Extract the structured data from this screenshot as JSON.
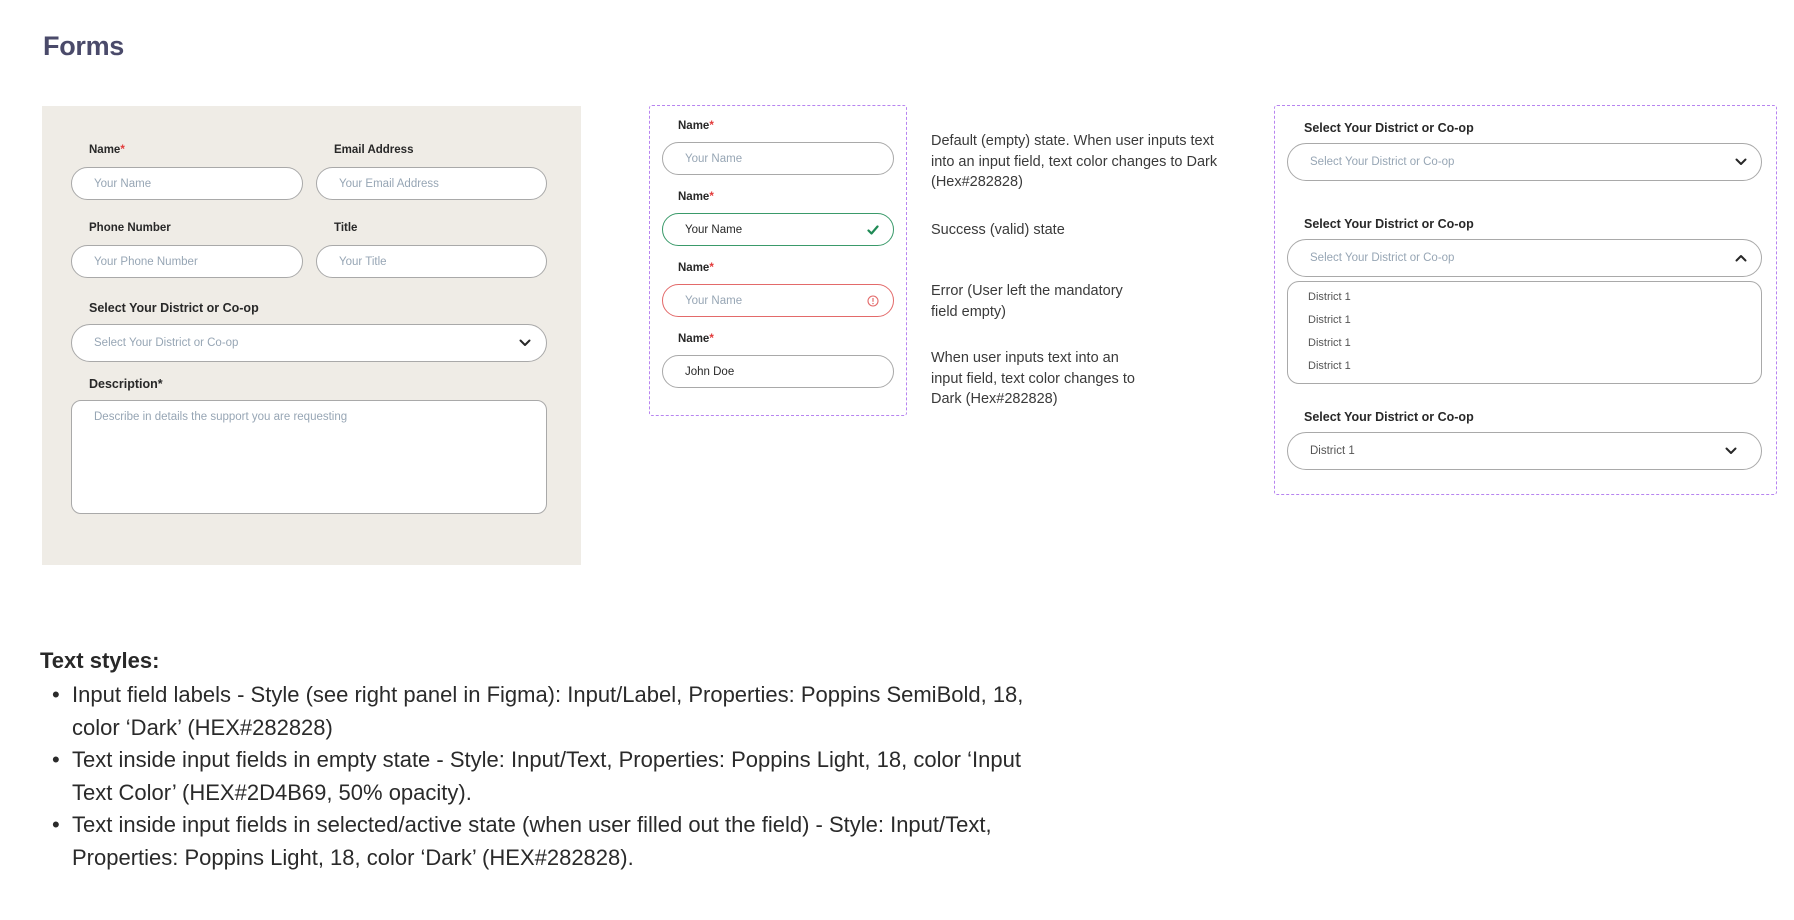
{
  "page": {
    "title": "Forms"
  },
  "form": {
    "name": {
      "label": "Name",
      "required_mark": "*",
      "placeholder": "Your Name"
    },
    "email": {
      "label": "Email Address",
      "placeholder": "Your Email Address"
    },
    "phone": {
      "label": "Phone Number",
      "placeholder": "Your Phone Number"
    },
    "title": {
      "label": "Title",
      "placeholder": "Your Title"
    },
    "district": {
      "label": "Select Your District or Co-op",
      "placeholder": "Select Your District or Co-op",
      "icon": "chevron-down-icon"
    },
    "description": {
      "label": "Description*",
      "placeholder": "Describe in details the support you are requesting"
    }
  },
  "states": [
    {
      "label": "Name",
      "required_mark": "*",
      "value": "Your Name",
      "state": "default",
      "note": "Default (empty) state. When user inputs text into an input field, text color changes to Dark (Hex#282828)"
    },
    {
      "label": "Name",
      "required_mark": "*",
      "value": "Your Name",
      "state": "success",
      "icon": "checkmark-icon",
      "note": "Success (valid) state"
    },
    {
      "label": "Name",
      "required_mark": "*",
      "value": "Your Name",
      "state": "error",
      "icon": "error-icon",
      "note": "Error (User left the mandatory field empty)"
    },
    {
      "label": "Name",
      "required_mark": "*",
      "value": "John Doe",
      "state": "filled",
      "note": "When user inputs text into an input field, text color changes to Dark (Hex#282828)"
    }
  ],
  "dropdowns": {
    "closed": {
      "label": "Select Your District or Co-op",
      "placeholder": "Select Your District or Co-op",
      "icon": "chevron-down-icon"
    },
    "open": {
      "label": "Select Your District or Co-op",
      "placeholder": "Select Your District or Co-op",
      "icon": "chevron-up-icon",
      "options": [
        "District 1",
        "District 1",
        "District 1",
        "District 1"
      ]
    },
    "selected": {
      "label": "Select Your District or Co-op",
      "value": "District 1",
      "icon": "chevron-down-icon"
    }
  },
  "text_styles": {
    "title": "Text styles:",
    "items": [
      "Input field labels - Style (see right panel in Figma): Input/Label, Properties: Poppins SemiBold, 18, color ‘Dark’ (HEX#282828)",
      "Text inside input fields in empty state - Style: Input/Text, Properties: Poppins Light, 18, color ‘Input Text Color’ (HEX#2D4B69, 50% opacity).",
      "Text inside input fields in selected/active state (when user filled out the field) - Style: Input/Text, Properties: Poppins Light, 18, color ‘Dark’ (HEX#282828)."
    ],
    "bullet": "•"
  },
  "colors": {
    "dark": "#282828",
    "input_text": "#2D4B69",
    "required": "#e23b3b",
    "success": "#3a9a6a",
    "error": "#e36a6a",
    "panel_bg": "#efece6",
    "dashed_border": "#b784f0"
  }
}
